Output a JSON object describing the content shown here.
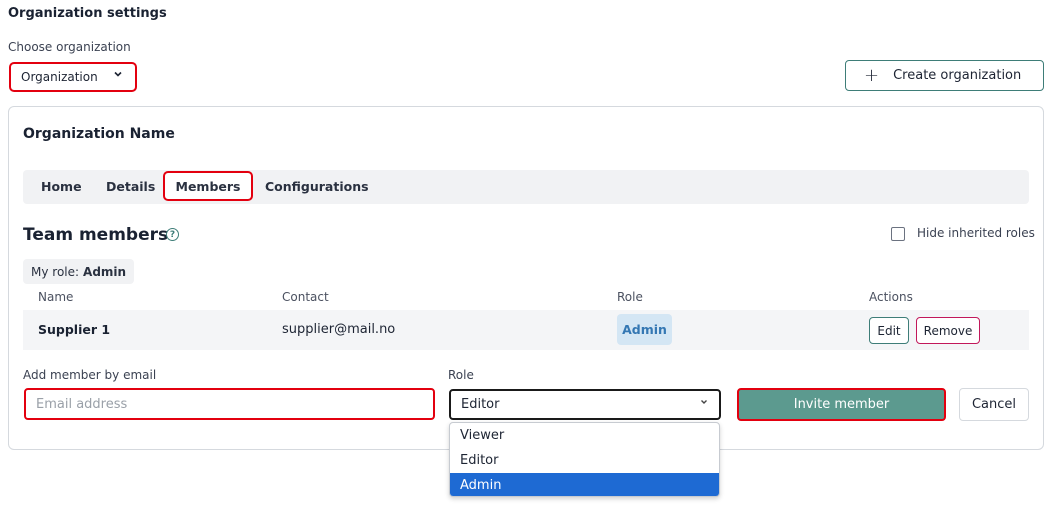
{
  "page_title": "Organization settings",
  "org_chooser": {
    "label": "Choose organization",
    "selected": "Organization",
    "chevron_icon": "chevron-down-icon"
  },
  "create_button": {
    "label": "Create organization",
    "icon": "plus-icon"
  },
  "organization_name": "Organization Name",
  "tabs": [
    {
      "label": "Home"
    },
    {
      "label": "Details"
    },
    {
      "label": "Members",
      "active": true
    },
    {
      "label": "Configurations"
    }
  ],
  "members": {
    "title": "Team members",
    "help_icon": "question-circle-icon",
    "hide_inherited_label": "Hide inherited roles",
    "my_role_label": "My role:",
    "my_role_value": "Admin",
    "columns": [
      "Name",
      "Contact",
      "Role",
      "Actions"
    ],
    "rows": [
      {
        "name": "Supplier 1",
        "contact": "supplier@mail.no",
        "role": "Admin",
        "edit_label": "Edit",
        "remove_label": "Remove"
      }
    ]
  },
  "add_member": {
    "email_label": "Add member by email",
    "email_placeholder": "Email address",
    "email_value": "",
    "role_label": "Role",
    "role_selected": "Editor",
    "role_options": [
      "Viewer",
      "Editor",
      "Admin"
    ],
    "highlighted_option": "Admin",
    "invite_label": "Invite member",
    "cancel_label": "Cancel"
  },
  "colors": {
    "accent": "#5c9a8f",
    "highlight_outline": "#e3000f",
    "option_highlight": "#1e6ad3",
    "role_badge_bg": "#d4e6f4"
  }
}
